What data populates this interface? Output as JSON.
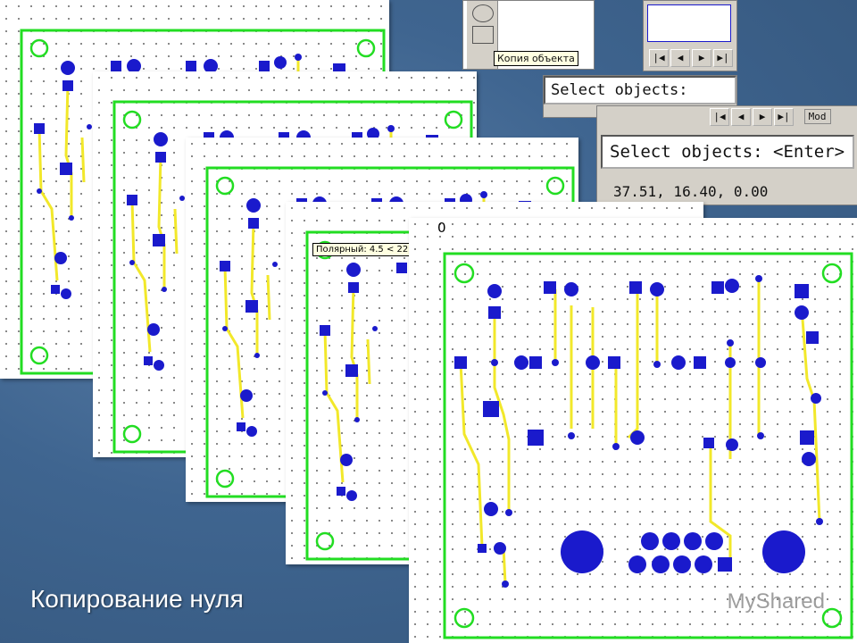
{
  "slide": {
    "caption": "Копирование нуля",
    "watermark": "MyShared"
  },
  "cad_window": {
    "tooltip": "Копия объекта",
    "command_prompt_1": "Select objects:",
    "command_prompt_2": "Select objects: <Enter>",
    "coordinates": "37.51, 16.40, 0.00",
    "polar_tooltip": "Полярный: 4.5 < 225",
    "origin_label": "0",
    "tab_partial": "Mod"
  },
  "colors": {
    "board_outline": "#22dd22",
    "pad": "#1a1acc",
    "trace": "#f2e82a",
    "background": "#3f6590"
  },
  "icons": [
    "copy-object-icon",
    "nav-first-icon",
    "nav-prev-icon",
    "nav-next-icon",
    "nav-last-icon"
  ]
}
